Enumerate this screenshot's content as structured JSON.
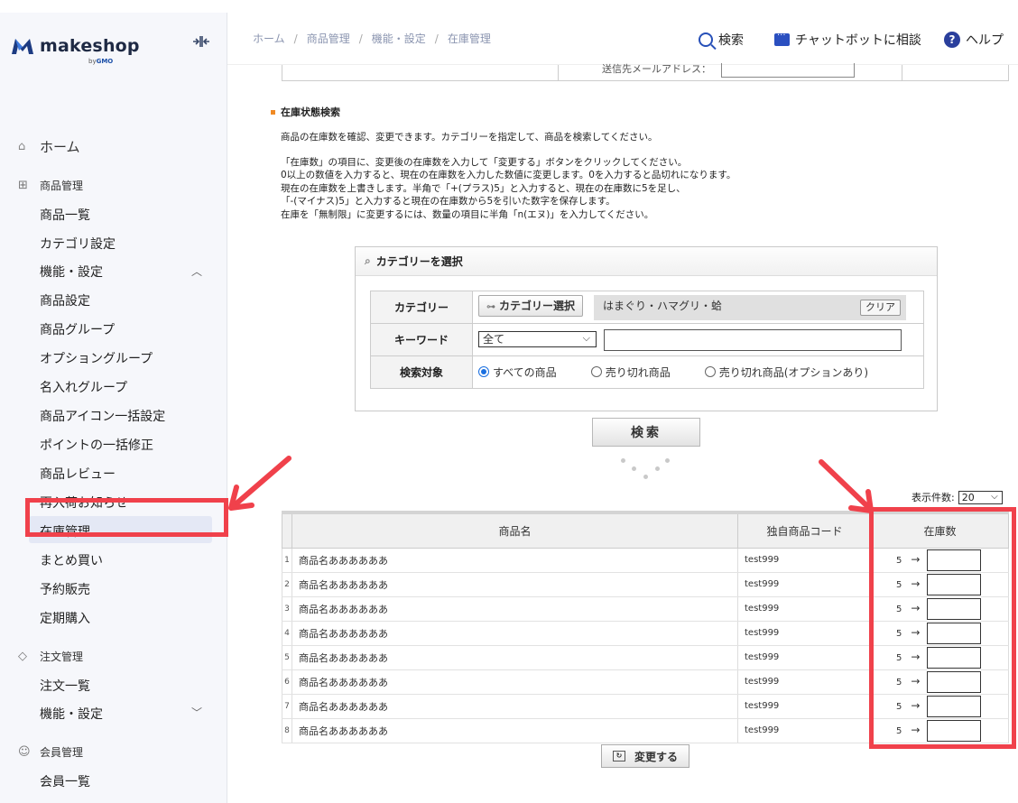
{
  "brand": {
    "name": "makeshop",
    "by": "by",
    "gmo": "GMO"
  },
  "header": {
    "breadcrumbs": [
      "ホーム",
      "商品管理",
      "機能・設定",
      "在庫管理"
    ],
    "search_label": "検索",
    "chatbot_label": "チャットボットに相談",
    "help_label": "ヘルプ"
  },
  "sidebar": {
    "home": "ホーム",
    "products_head": "商品管理",
    "products_items": [
      "商品一覧",
      "カテゴリ設定",
      "機能・設定",
      "商品設定",
      "商品グループ",
      "オプショングループ",
      "名入れグループ",
      "商品アイコン一括設定",
      "ポイントの一括修正",
      "商品レビュー",
      "再入荷お知らせ",
      "在庫管理",
      "まとめ買い",
      "予約販売",
      "定期購入"
    ],
    "orders_head": "注文管理",
    "orders_items": [
      "注文一覧",
      "機能・設定"
    ],
    "members_head": "会員管理",
    "members_items": [
      "会員一覧"
    ],
    "active_item": "在庫管理"
  },
  "top_strip": {
    "cut_label": "送信先メールアドレス："
  },
  "section": {
    "title": "在庫状態検索",
    "intro": "商品の在庫数を確認、変更できます。カテゴリーを指定して、商品を検索してください。",
    "lines": [
      "「在庫数」の項目に、変更後の在庫数を入力して「変更する」ボタンをクリックしてください。",
      "0以上の数値を入力すると、現在の在庫数を入力した数値に変更します。0を入力すると品切れになります。",
      "現在の在庫数を上書きします。半角で「+(プラス)5」と入力すると、現在の在庫数に5を足し、",
      "「-(マイナス)5」と入力すると現在の在庫数から5を引いた数字を保存します。",
      "在庫を「無制限」に変更するには、数量の項目に半角「n(エヌ)」を入力してください。"
    ]
  },
  "category_panel": {
    "title": "カテゴリーを選択",
    "category_label": "カテゴリー",
    "category_button": "カテゴリー選択",
    "category_value": "はまぐり・ハマグリ・蛤",
    "clear_button": "クリア",
    "keyword_label": "キーワード",
    "keyword_scope": "全て",
    "keyword_value": "",
    "target_label": "検索対象",
    "targets": [
      "すべての商品",
      "売り切れ商品",
      "売り切れ商品(オプションあり)"
    ]
  },
  "search_button": "検索",
  "per_page": {
    "label": "表示件数:",
    "value": "20"
  },
  "results": {
    "headers": [
      "商品名",
      "独自商品コード",
      "在庫数"
    ],
    "rows": [
      {
        "no": "1",
        "name": "商品名ああああああ",
        "code": "test999",
        "stock": "5",
        "arrow": "→"
      },
      {
        "no": "2",
        "name": "商品名ああああああ",
        "code": "test999",
        "stock": "5",
        "arrow": "→"
      },
      {
        "no": "3",
        "name": "商品名ああああああ",
        "code": "test999",
        "stock": "5",
        "arrow": "→"
      },
      {
        "no": "4",
        "name": "商品名ああああああ",
        "code": "test999",
        "stock": "5",
        "arrow": "→"
      },
      {
        "no": "5",
        "name": "商品名ああああああ",
        "code": "test999",
        "stock": "5",
        "arrow": "→"
      },
      {
        "no": "6",
        "name": "商品名ああああああ",
        "code": "test999",
        "stock": "5",
        "arrow": "→"
      },
      {
        "no": "7",
        "name": "商品名ああああああ",
        "code": "test999",
        "stock": "5",
        "arrow": "→"
      },
      {
        "no": "8",
        "name": "商品名ああああああ",
        "code": "test999",
        "stock": "5",
        "arrow": "→"
      }
    ]
  },
  "change_button": "変更する",
  "colors": {
    "highlight": "#f0414b",
    "accent": "#2750b8",
    "section_marker": "#f08a24"
  }
}
